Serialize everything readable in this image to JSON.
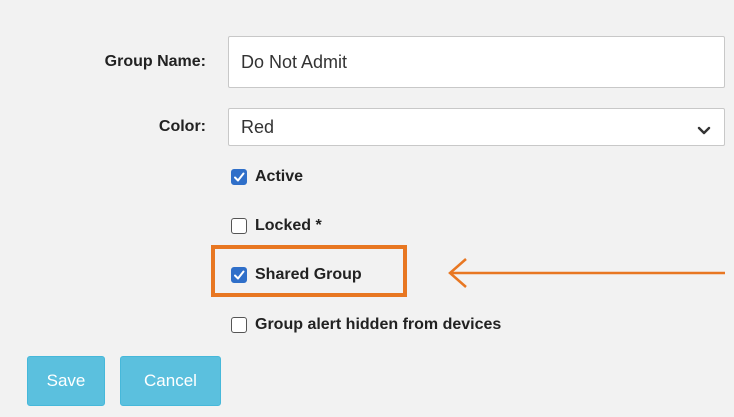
{
  "form": {
    "group_name_label": "Group Name:",
    "group_name_value": "Do Not Admit",
    "color_label": "Color:",
    "color_value": "Red",
    "checkboxes": [
      {
        "label": "Active",
        "checked": true
      },
      {
        "label": "Locked *",
        "checked": false
      },
      {
        "label": "Shared Group",
        "checked": true
      },
      {
        "label": "Group alert hidden from devices",
        "checked": false
      }
    ]
  },
  "buttons": {
    "save_label": "Save",
    "cancel_label": "Cancel"
  },
  "icons": {
    "select_chevron": "chevron-down-icon",
    "checkmark": "check-icon",
    "callout": "arrow-left-icon"
  },
  "colors": {
    "background": "#f2f2f2",
    "checkbox_checked": "#2f6fc9",
    "button": "#5bc0de",
    "highlight": "#e87722"
  }
}
